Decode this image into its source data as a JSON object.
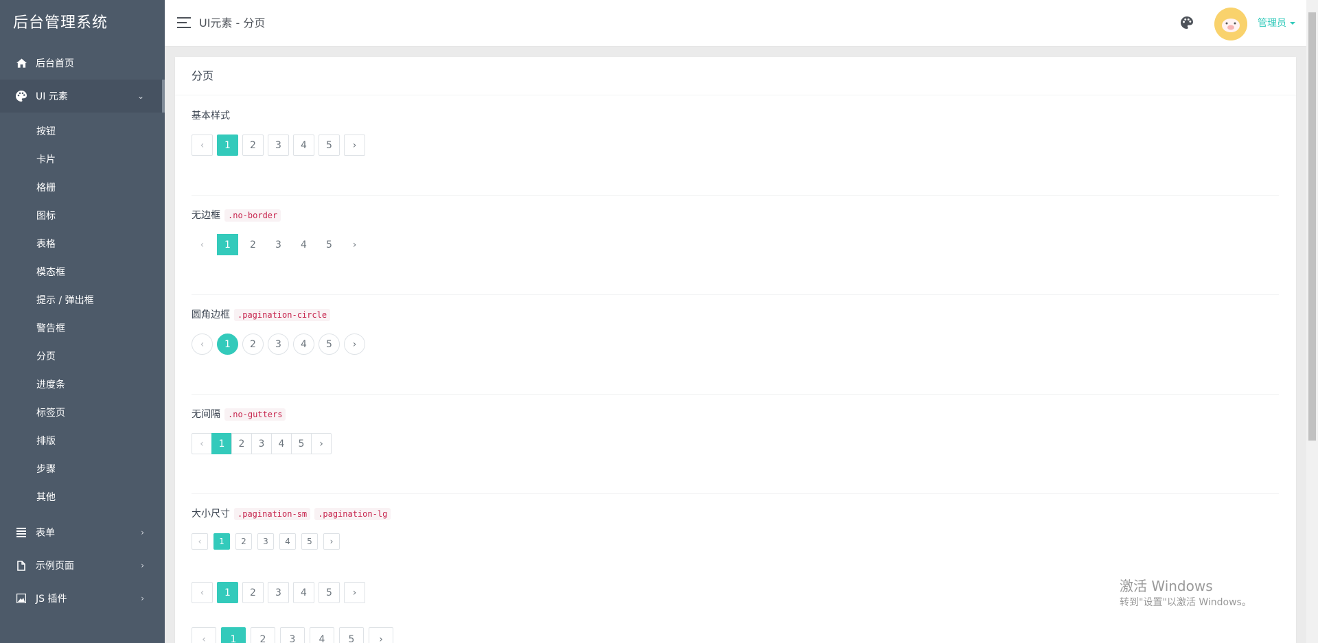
{
  "sidebar": {
    "brand": "后台管理系统",
    "home": {
      "label": "后台首页",
      "icon": "home-icon"
    },
    "ui": {
      "label": "UI 元素",
      "icon": "palette-icon"
    },
    "sub_items": [
      "按钮",
      "卡片",
      "格栅",
      "图标",
      "表格",
      "模态框",
      "提示 / 弹出框",
      "警告框",
      "分页",
      "进度条",
      "标签页",
      "排版",
      "步骤",
      "其他"
    ],
    "form": {
      "label": "表单",
      "icon": "list-icon"
    },
    "examples": {
      "label": "示例页面",
      "icon": "file-icon"
    },
    "plugins": {
      "label": "JS 插件",
      "icon": "image-icon"
    }
  },
  "topbar": {
    "breadcrumb": "UI元素 - 分页",
    "user_label": "管理员"
  },
  "card": {
    "title": "分页",
    "sections": {
      "basic": {
        "label": "基本样式"
      },
      "noborder": {
        "label": "无边框",
        "code": ".no-border"
      },
      "circle": {
        "label": "圆角边框",
        "code": ".pagination-circle"
      },
      "gutters": {
        "label": "无间隔",
        "code": ".no-gutters"
      },
      "sizes": {
        "label": "大小尺寸",
        "code1": ".pagination-sm",
        "code2": ".pagination-lg"
      }
    }
  },
  "pagination": {
    "prev": "‹",
    "next": "›",
    "pages": [
      "1",
      "2",
      "3",
      "4",
      "5"
    ],
    "active_page": "1"
  },
  "colors": {
    "accent": "#33cabb",
    "sidebar_bg": "#4d5a69",
    "code_text": "#c7254e",
    "code_bg": "#f9f2f4"
  },
  "watermark": {
    "line1": "激活 Windows",
    "line2": "转到\"设置\"以激活 Windows。"
  }
}
